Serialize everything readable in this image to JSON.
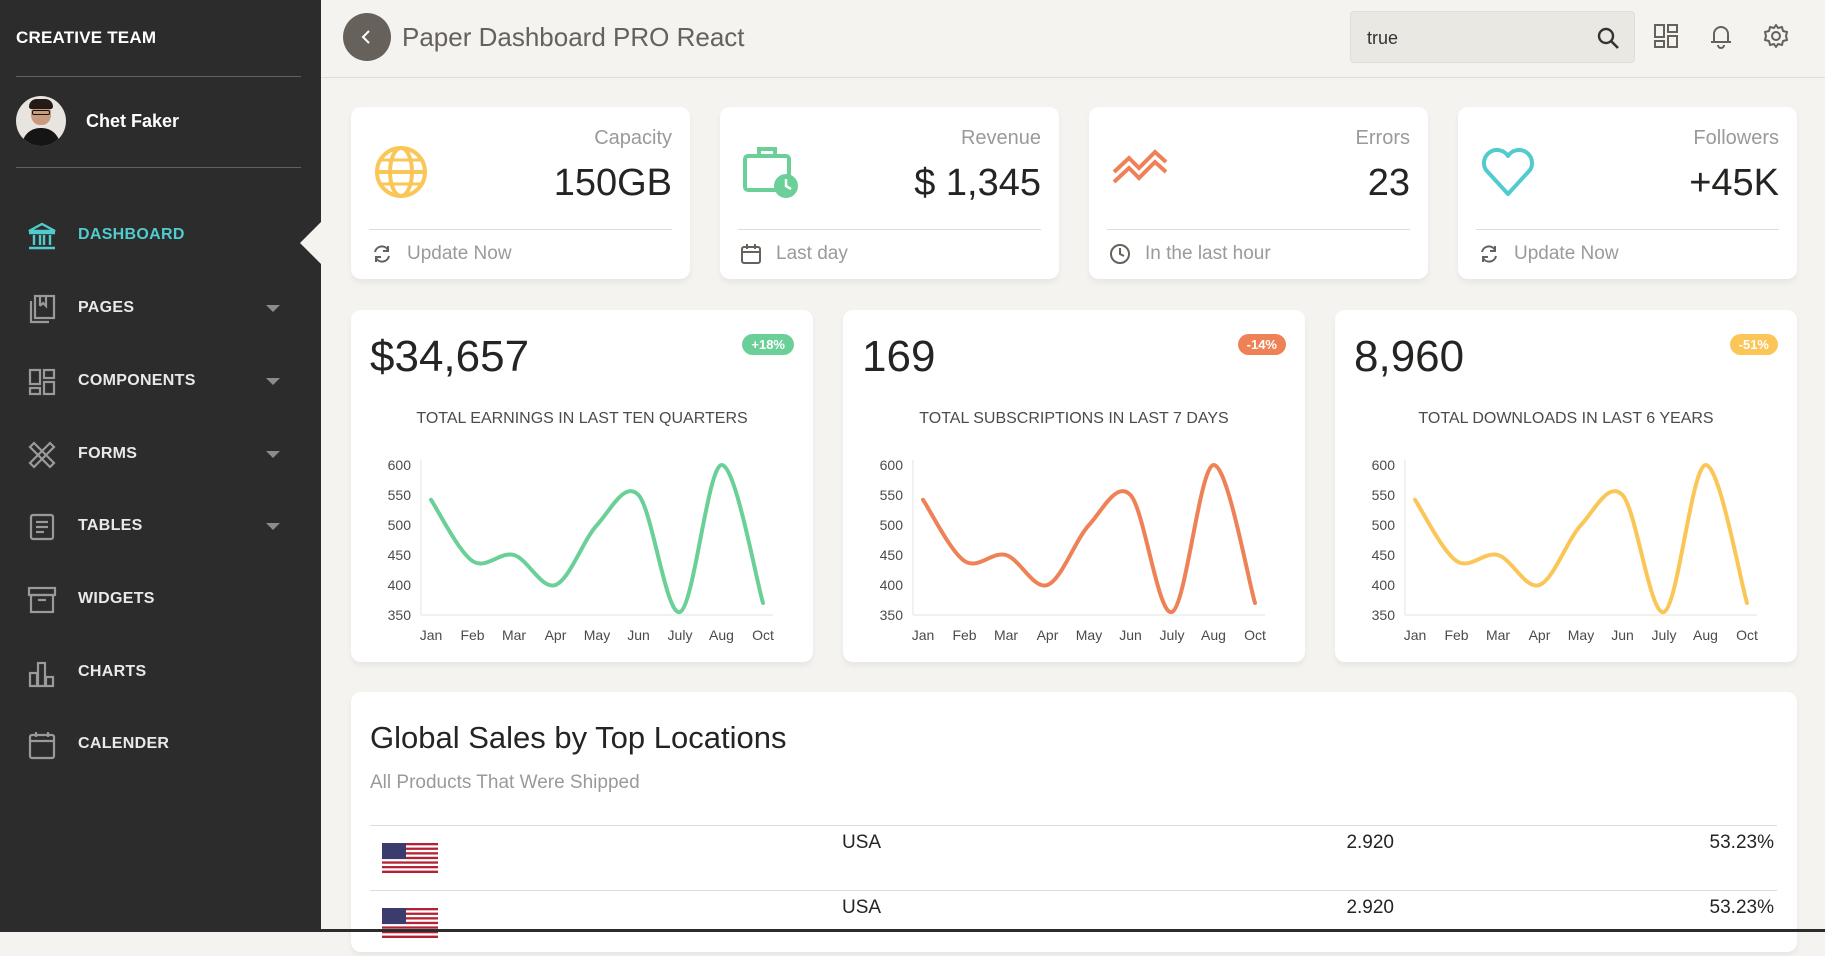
{
  "sidebar": {
    "brand": "CREATIVE TEAM",
    "user_name": "Chet Faker",
    "items": [
      {
        "label": "DASHBOARD",
        "icon": "bank-icon",
        "active": true,
        "expandable": false
      },
      {
        "label": "PAGES",
        "icon": "book-icon",
        "active": false,
        "expandable": true
      },
      {
        "label": "COMPONENTS",
        "icon": "layout-icon",
        "active": false,
        "expandable": true
      },
      {
        "label": "FORMS",
        "icon": "ruler-pencil-icon",
        "active": false,
        "expandable": true
      },
      {
        "label": "TABLES",
        "icon": "paper-icon",
        "active": false,
        "expandable": true
      },
      {
        "label": "WIDGETS",
        "icon": "box-icon",
        "active": false,
        "expandable": false
      },
      {
        "label": "CHARTS",
        "icon": "chart-bar-icon",
        "active": false,
        "expandable": false
      },
      {
        "label": "CALENDER",
        "icon": "calendar-icon",
        "active": false,
        "expandable": false
      }
    ]
  },
  "header": {
    "title": "Paper Dashboard PRO React",
    "search_value": "true",
    "icons": [
      "search-icon",
      "grid-icon",
      "bell-icon",
      "gear-icon"
    ]
  },
  "stats": [
    {
      "label": "Capacity",
      "value": "150GB",
      "footer": "Update Now",
      "icon": "globe-icon",
      "footer_icon": "refresh-icon",
      "color": "#fbc658"
    },
    {
      "label": "Revenue",
      "value": "$ 1,345",
      "footer": "Last day",
      "icon": "money-clock-icon",
      "footer_icon": "calendar-icon",
      "color": "#6bd098"
    },
    {
      "label": "Errors",
      "value": "23",
      "footer": "In the last hour",
      "icon": "vector-icon",
      "footer_icon": "clock-icon",
      "color": "#ef8157"
    },
    {
      "label": "Followers",
      "value": "+45K",
      "footer": "Update Now",
      "icon": "heart-icon",
      "footer_icon": "refresh-icon",
      "color": "#51cbce"
    }
  ],
  "charts": [
    {
      "big": "$34,657",
      "badge": "+18%",
      "badge_color": "#6bd098",
      "title": "TOTAL EARNINGS IN LAST TEN QUARTERS"
    },
    {
      "big": "169",
      "badge": "-14%",
      "badge_color": "#ef8157",
      "title": "TOTAL SUBSCRIPTIONS IN LAST 7 DAYS"
    },
    {
      "big": "8,960",
      "badge": "-51%",
      "badge_color": "#fbc658",
      "title": "TOTAL DOWNLOADS IN LAST 6 YEARS"
    }
  ],
  "chart_data": [
    {
      "type": "line",
      "title": "TOTAL EARNINGS IN LAST TEN QUARTERS",
      "categories": [
        "Jan",
        "Feb",
        "Mar",
        "Apr",
        "May",
        "Jun",
        "July",
        "Aug",
        "Oct"
      ],
      "values": [
        542,
        440,
        450,
        400,
        500,
        550,
        355,
        600,
        370
      ],
      "ylim": [
        350,
        600
      ],
      "yticks": [
        350,
        400,
        450,
        500,
        550,
        600
      ],
      "color": "#6bd098"
    },
    {
      "type": "line",
      "title": "TOTAL SUBSCRIPTIONS IN LAST 7 DAYS",
      "categories": [
        "Jan",
        "Feb",
        "Mar",
        "Apr",
        "May",
        "Jun",
        "July",
        "Aug",
        "Oct"
      ],
      "values": [
        542,
        440,
        450,
        400,
        500,
        550,
        355,
        600,
        370
      ],
      "ylim": [
        350,
        600
      ],
      "yticks": [
        350,
        400,
        450,
        500,
        550,
        600
      ],
      "color": "#ef8157"
    },
    {
      "type": "line",
      "title": "TOTAL DOWNLOADS IN LAST 6 YEARS",
      "categories": [
        "Jan",
        "Feb",
        "Mar",
        "Apr",
        "May",
        "Jun",
        "July",
        "Aug",
        "Oct"
      ],
      "values": [
        542,
        440,
        450,
        400,
        500,
        550,
        355,
        600,
        370
      ],
      "ylim": [
        350,
        600
      ],
      "yticks": [
        350,
        400,
        450,
        500,
        550,
        600
      ],
      "color": "#fbc658"
    }
  ],
  "sales": {
    "title": "Global Sales by Top Locations",
    "subtitle": "All Products That Were Shipped",
    "rows": [
      {
        "flag": "us-flag-icon",
        "country": "USA",
        "sales": "2.920",
        "percent": "53.23%"
      },
      {
        "flag": "us-flag-icon",
        "country": "USA",
        "sales": "2.920",
        "percent": "53.23%"
      }
    ]
  }
}
